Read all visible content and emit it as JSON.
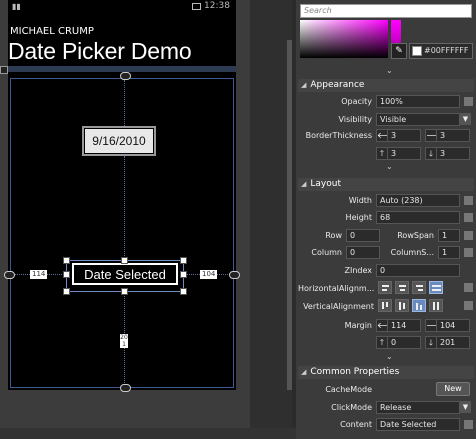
{
  "designer": {
    "status_time": "12:38",
    "app_title": "MICHAEL CRUMP",
    "page_title": "Date Picker Demo",
    "date_value": "9/16/2010",
    "selected_button_label": "Date Selected",
    "margin_left_label": "114",
    "margin_right_label": "104",
    "margin_bottom_label": "201"
  },
  "panel": {
    "search_placeholder": "Search",
    "color_hex": "#00FFFFFF",
    "appearance": {
      "title": "Appearance",
      "opacity_label": "Opacity",
      "opacity_value": "100%",
      "visibility_label": "Visibility",
      "visibility_value": "Visible",
      "borderthickness_label": "BorderThickness",
      "bt_left": "3",
      "bt_right": "3",
      "bt_top": "3",
      "bt_bottom": "3"
    },
    "layout": {
      "title": "Layout",
      "width_label": "Width",
      "width_value": "Auto (238)",
      "height_label": "Height",
      "height_value": "68",
      "row_label": "Row",
      "row_value": "0",
      "rowspan_label": "RowSpan",
      "rowspan_value": "1",
      "column_label": "Column",
      "column_value": "0",
      "columnspan_label": "ColumnS...",
      "columnspan_value": "1",
      "zindex_label": "ZIndex",
      "zindex_value": "0",
      "halign_label": "HorizontalAlignm...",
      "valign_label": "VerticalAlignment",
      "margin_label": "Margin",
      "margin_left": "114",
      "margin_right": "104",
      "margin_top": "0",
      "margin_bottom": "201"
    },
    "common": {
      "title": "Common Properties",
      "cachemode_label": "CacheMode",
      "new_button": "New",
      "clickmode_label": "ClickMode",
      "clickmode_value": "Release",
      "content_label": "Content",
      "content_value": "Date Selected"
    },
    "colors": {
      "accent_selected": "#6a8bbf",
      "gradient_end": "#ff00ff"
    }
  }
}
